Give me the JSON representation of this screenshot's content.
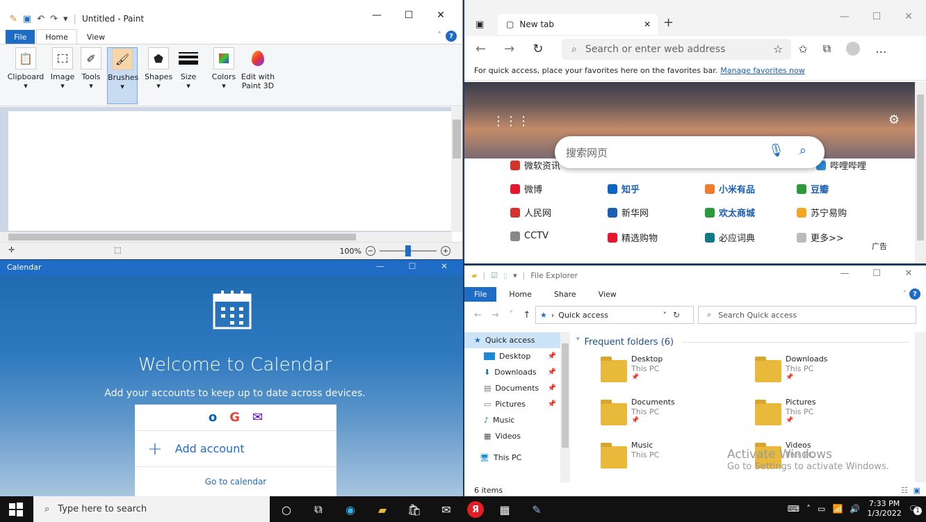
{
  "paint": {
    "title": "Untitled - Paint",
    "tabs": [
      "File",
      "Home",
      "View"
    ],
    "groups": [
      {
        "label": "Clipboard",
        "icon": "clipboard-icon"
      },
      {
        "label": "Image",
        "icon": "select-icon"
      },
      {
        "label": "Tools",
        "icon": "tools-icon"
      },
      {
        "label": "Brushes",
        "icon": "brush-icon"
      },
      {
        "label": "Shapes",
        "icon": "shapes-icon"
      },
      {
        "label": "Size",
        "icon": "size-icon"
      },
      {
        "label": "Colors",
        "icon": "colors-icon"
      },
      {
        "label": "Edit with Paint 3D",
        "icon": "paint3d-icon"
      }
    ],
    "zoom": "100%",
    "zoom_level": 0.5
  },
  "edge": {
    "tab_title": "New tab",
    "address_placeholder": "Search or enter web address",
    "favbar_text": "For quick access, place your favorites here on the favorites bar.",
    "favbar_link": "Manage favorites now",
    "search_placeholder": "搜索网页",
    "links": [
      {
        "label": "微软资讯",
        "color": "#d0342c",
        "blue": false
      },
      {
        "label": "哔哩哔哩",
        "color": "#2e8bd6",
        "blue": false
      },
      {
        "label": "微博",
        "color": "#e6162d",
        "blue": false
      },
      {
        "label": "知乎",
        "color": "#0a66c2",
        "blue": true
      },
      {
        "label": "小米有品",
        "color": "#f07b2a",
        "blue": true
      },
      {
        "label": "豆瓣",
        "color": "#2a9a3a",
        "blue": true
      },
      {
        "label": "人民网",
        "color": "#d0342c",
        "blue": false
      },
      {
        "label": "新华网",
        "color": "#1a5fb4",
        "blue": false
      },
      {
        "label": "欢太商城",
        "color": "#2a9a3a",
        "blue": true
      },
      {
        "label": "苏宁易购",
        "color": "#f5a623",
        "blue": false
      },
      {
        "label": "CCTV",
        "color": "#888888",
        "blue": false
      },
      {
        "label": "精选购物",
        "color": "#e6162d",
        "blue": false
      },
      {
        "label": "必应词典",
        "color": "#0e7c86",
        "blue": false
      },
      {
        "label": "更多>>",
        "color": "#bbbbbb",
        "blue": false
      }
    ],
    "ad_label": "广告"
  },
  "calendar": {
    "title": "Calendar",
    "welcome": "Welcome to Calendar",
    "subtitle": "Add your accounts to keep up to date across devices.",
    "add_account": "Add account",
    "go_to_calendar": "Go to calendar",
    "providers": [
      {
        "label": "o",
        "color": "#0364b8"
      },
      {
        "label": "G",
        "color": "#ea4335"
      },
      {
        "label": "✉",
        "color": "#6001d2"
      }
    ]
  },
  "explorer": {
    "title": "File Explorer",
    "tabs": [
      "File",
      "Home",
      "Share",
      "View"
    ],
    "path": "Quick access",
    "search_placeholder": "Search Quick access",
    "nav_items": [
      {
        "label": "Quick access",
        "pinned": false
      },
      {
        "label": "Desktop",
        "pinned": true
      },
      {
        "label": "Downloads",
        "pinned": true
      },
      {
        "label": "Documents",
        "pinned": true
      },
      {
        "label": "Pictures",
        "pinned": true
      },
      {
        "label": "Music",
        "pinned": false
      },
      {
        "label": "Videos",
        "pinned": false
      },
      {
        "label": "This PC",
        "pinned": false
      }
    ],
    "group_header": "Frequent folders (6)",
    "folders": [
      {
        "name": "Desktop",
        "location": "This PC"
      },
      {
        "name": "Downloads",
        "location": "This PC"
      },
      {
        "name": "Documents",
        "location": "This PC"
      },
      {
        "name": "Pictures",
        "location": "This PC"
      },
      {
        "name": "Music",
        "location": "This PC"
      },
      {
        "name": "Videos",
        "location": "This PC"
      }
    ],
    "item_count": "6 items",
    "watermark_line1": "Activate Windows",
    "watermark_line2": "Go to Settings to activate Windows."
  },
  "taskbar": {
    "search_placeholder": "Type here to search",
    "time": "7:33 PM",
    "date": "1/3/2022",
    "notification_count": "1"
  }
}
